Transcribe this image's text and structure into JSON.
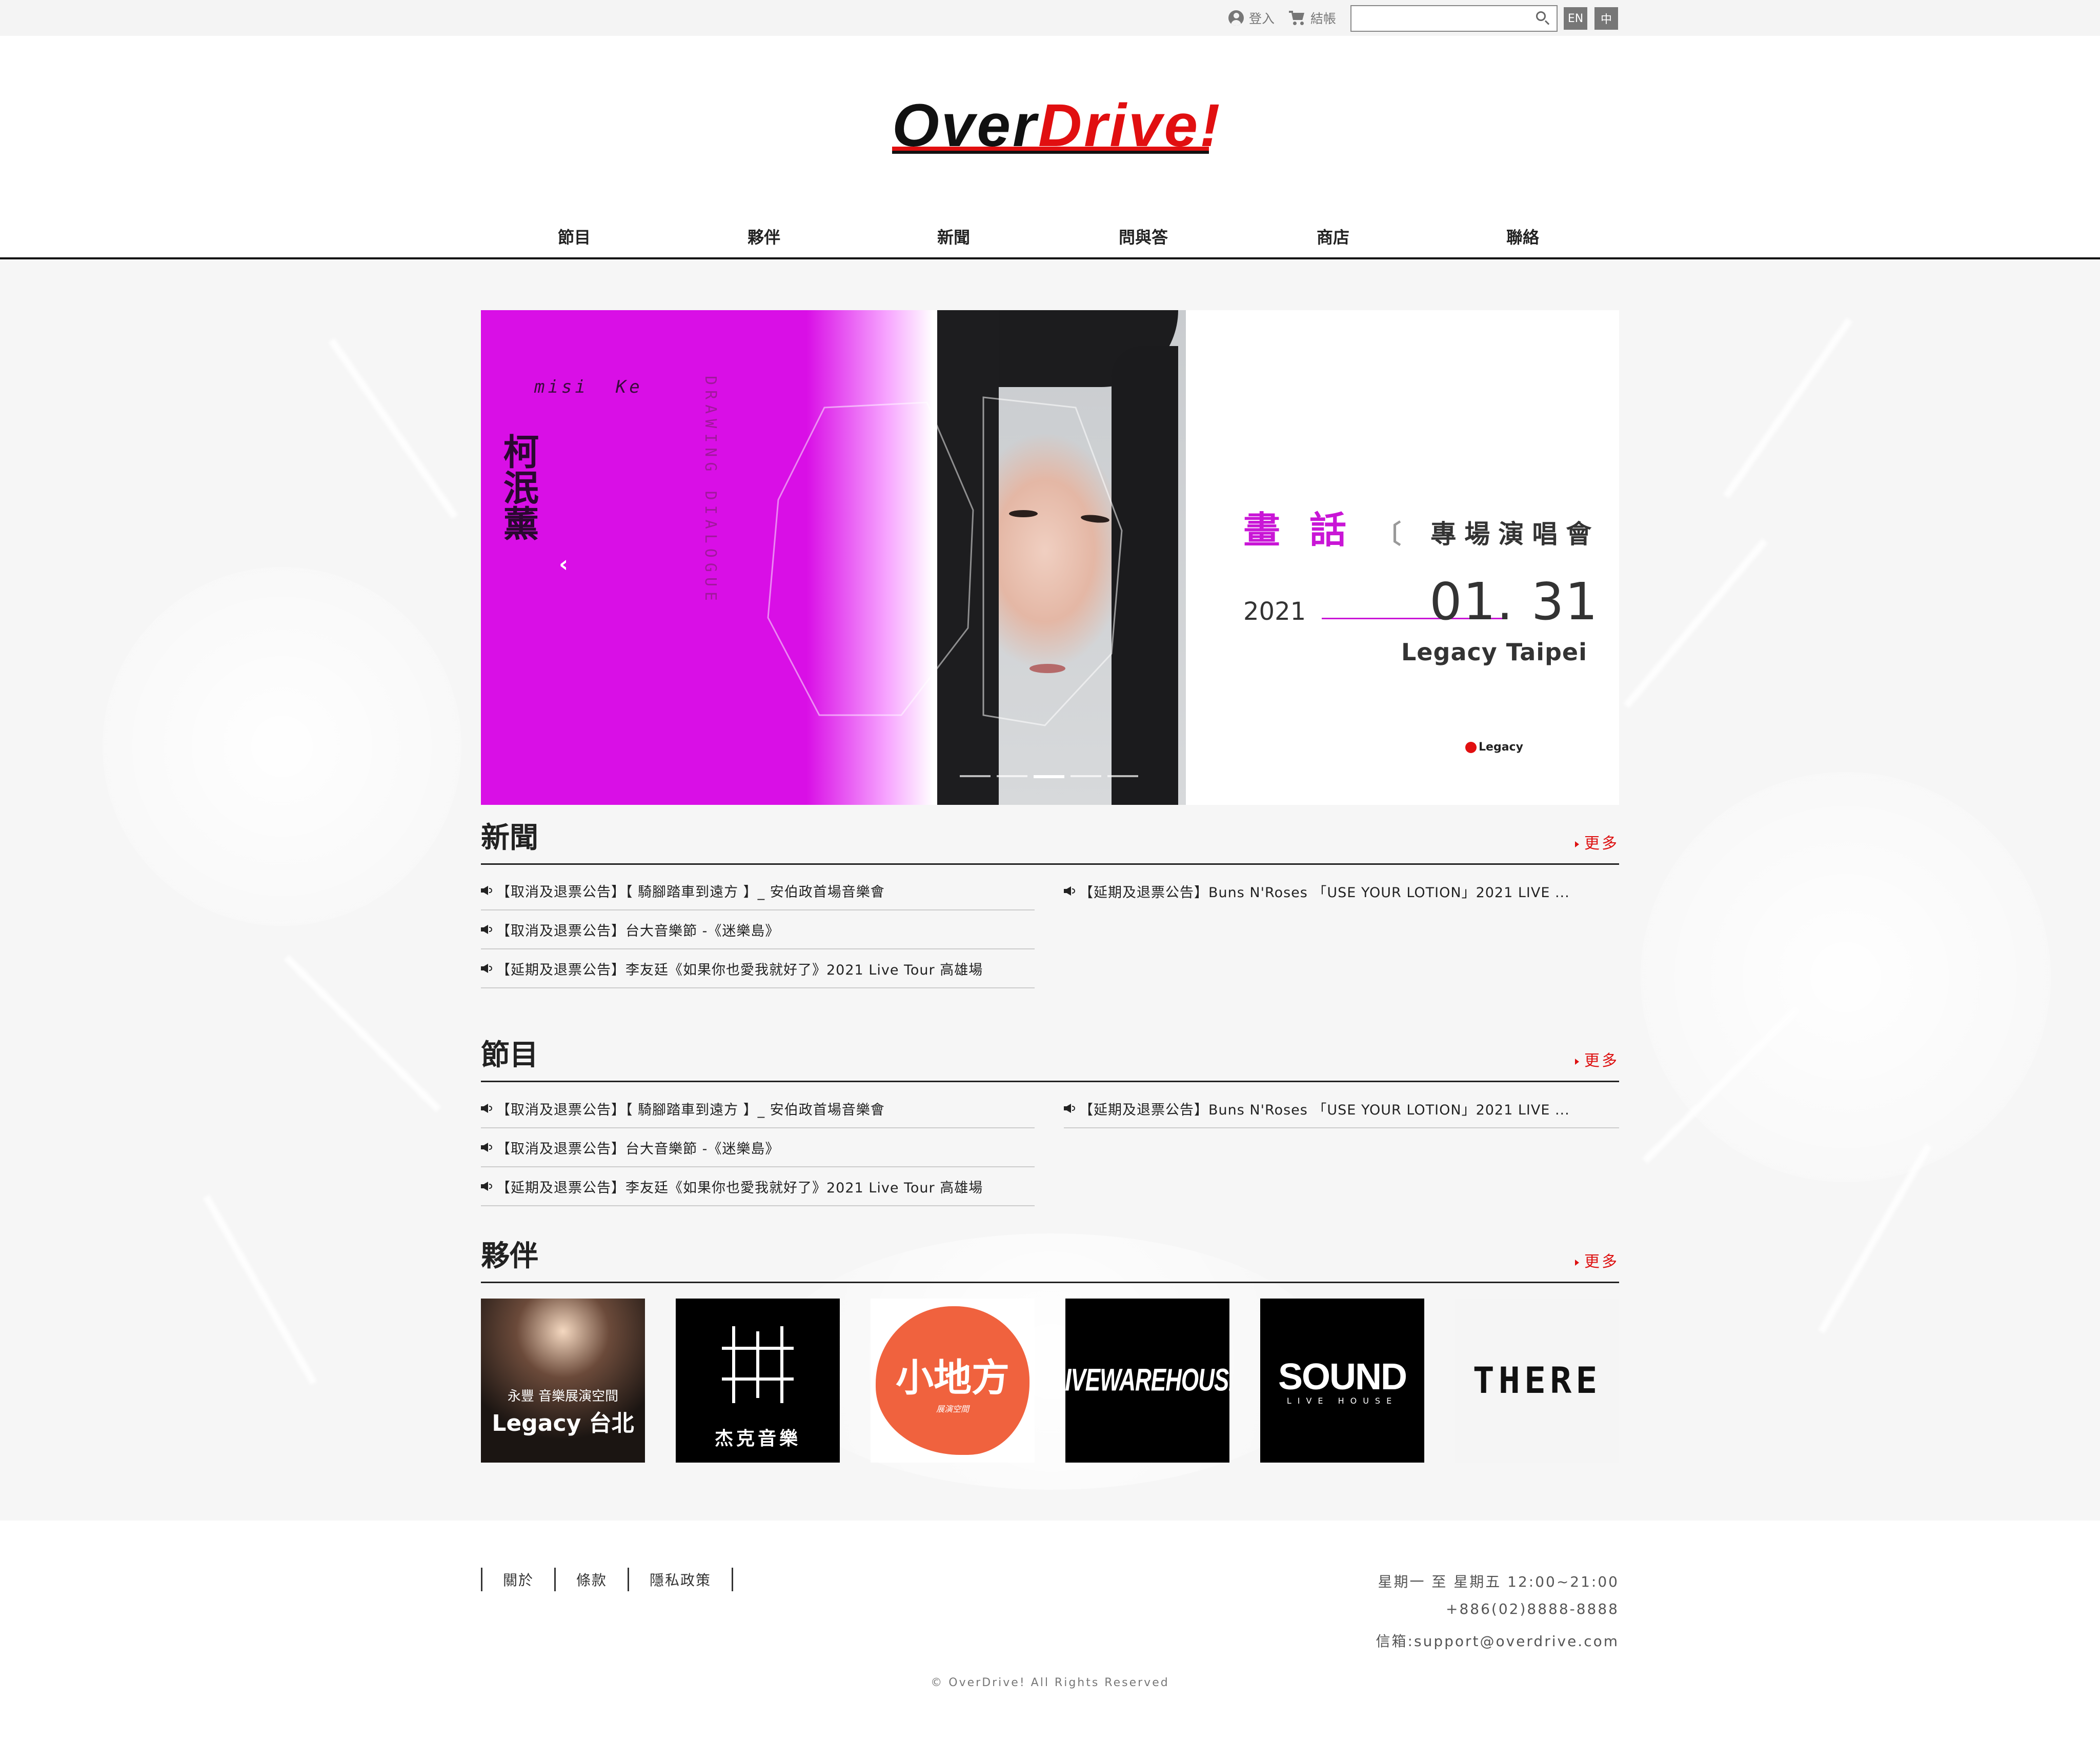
{
  "topbar": {
    "login_label": "登入",
    "cart_label": "結帳",
    "search_placeholder": "",
    "lang_en": "EN",
    "lang_zh": "中"
  },
  "logo": {
    "part1": "Over",
    "part2": "Drive!"
  },
  "nav": [
    "節目",
    "夥伴",
    "新聞",
    "問與答",
    "商店",
    "聯絡"
  ],
  "banner": {
    "artist_en": "misi  Ke",
    "artist_zh": "柯泯薰",
    "vertical_subtitle": "DRAWING DIALOGUE",
    "title_main": "畫 話",
    "title_sub": "專場演唱會",
    "year": "2021",
    "date": "01. 31",
    "venue": "Legacy Taipei",
    "sponsor": "Legacy",
    "prev_arrow": "‹",
    "dots_total": 5,
    "dots_active": 3
  },
  "colors": {
    "brand_red": "#e10f10",
    "banner_purple": "#d90fe6",
    "link_red": "#dd1111"
  },
  "news": {
    "title": "新聞",
    "more": "更多",
    "left": [
      "【取消及退票公告】【 騎腳踏車到遠方 】_ 安伯政首場音樂會",
      "【取消及退票公告】台大音樂節 -《迷樂島》",
      "【延期及退票公告】李友廷《如果你也愛我就好了》2021 Live Tour 高雄場"
    ],
    "right": [
      "【延期及退票公告】Buns N'Roses 「USE YOUR LOTION」2021 LIVE ..."
    ]
  },
  "programs": {
    "title": "節目",
    "more": "更多",
    "left": [
      "【取消及退票公告】【 騎腳踏車到遠方 】_ 安伯政首場音樂會",
      "【取消及退票公告】台大音樂節 -《迷樂島》",
      "【延期及退票公告】李友廷《如果你也愛我就好了》2021 Live Tour 高雄場"
    ],
    "right": [
      "【延期及退票公告】Buns N'Roses 「USE YOUR LOTION」2021 LIVE ..."
    ]
  },
  "partners": {
    "title": "夥伴",
    "more": "更多",
    "items": [
      {
        "top": "永豐 音樂展演空間",
        "main": "Legacy 台北"
      },
      {
        "main": "杰克音樂"
      },
      {
        "main": "小地方",
        "sub": "展演空間"
      },
      {
        "main": "LIVEWAREHOUSE"
      },
      {
        "main": "SOUND",
        "sub": "LIVE HOUSE"
      },
      {
        "main": "THERE"
      }
    ]
  },
  "footer": {
    "links": [
      "關於",
      "條款",
      "隱私政策"
    ],
    "hours": "星期一 至 星期五 12:00~21:00",
    "phone": "+886(02)8888-8888",
    "email": "信箱:support@overdrive.com",
    "copyright": "© OverDrive! All Rights Reserved"
  }
}
